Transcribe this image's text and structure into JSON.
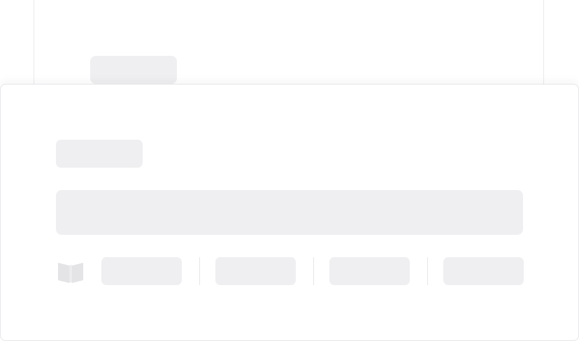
{
  "state": "loading-skeleton",
  "colors": {
    "placeholder": "#efeff1",
    "border": "#e6e6e9",
    "background": "#ffffff",
    "icon": "#e4e4e7"
  },
  "back_card": {
    "title": ""
  },
  "front_card": {
    "title": "",
    "description": "",
    "icon": "book-icon",
    "meta": [
      "",
      "",
      "",
      ""
    ]
  }
}
